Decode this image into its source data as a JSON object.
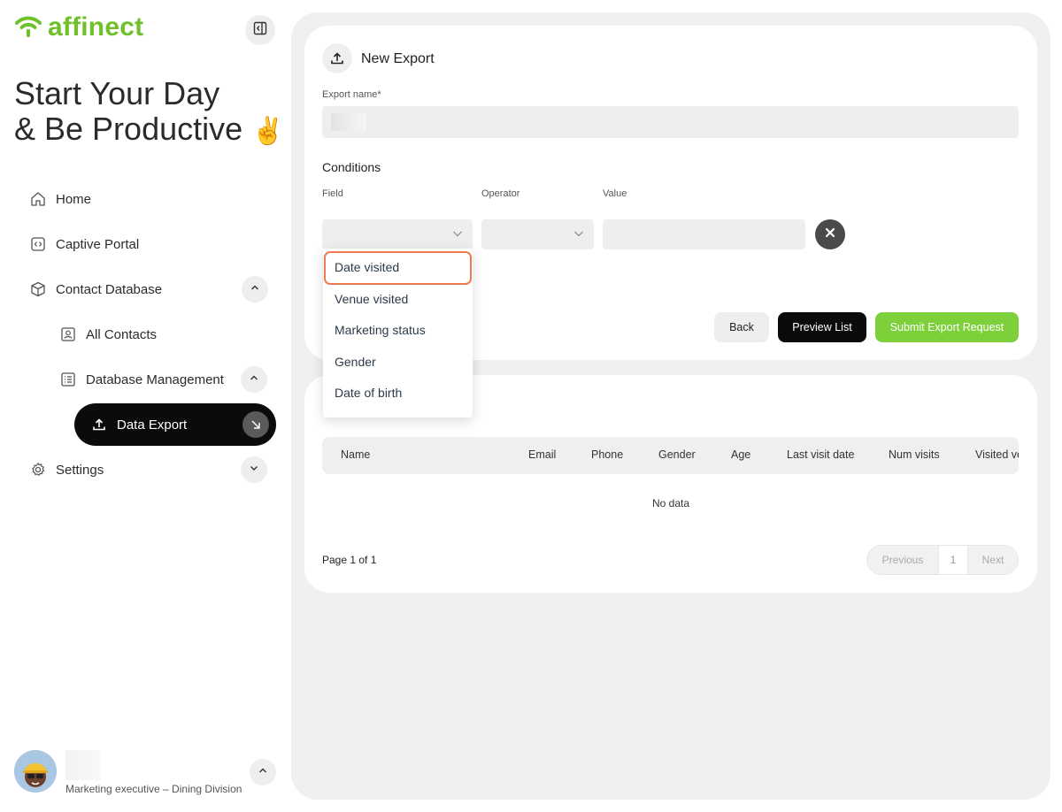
{
  "brand": {
    "name": "affinect",
    "color": "#6fc02b"
  },
  "headline": {
    "line1": "Start Your Day",
    "line2": "& Be Productive",
    "emoji": "✌️"
  },
  "nav": {
    "home": "Home",
    "captive_portal": "Captive Portal",
    "contact_database": "Contact Database",
    "all_contacts": "All Contacts",
    "database_management": "Database Management",
    "data_export": "Data Export",
    "settings": "Settings"
  },
  "user": {
    "role": "Marketing executive – Dining Division"
  },
  "export_form": {
    "title": "New Export",
    "export_name_label": "Export name*",
    "conditions_label": "Conditions",
    "field_label": "Field",
    "operator_label": "Operator",
    "value_label": "Value",
    "back_label": "Back",
    "preview_label": "Preview List",
    "submit_label": "Submit Export Request"
  },
  "field_dropdown": {
    "options": [
      "Date visited",
      "Venue visited",
      "Marketing status",
      "Gender",
      "Date of birth"
    ],
    "highlighted": "Date visited"
  },
  "table": {
    "columns": [
      "Name",
      "Email",
      "Phone",
      "Gender",
      "Age",
      "Last visit date",
      "Num visits",
      "Visited ve"
    ],
    "empty_text": "No data",
    "page_info": "Page 1 of 1",
    "prev_label": "Previous",
    "page_number": "1",
    "next_label": "Next"
  },
  "colors": {
    "accent_green": "#7ed03a",
    "highlight_orange": "#ee7b4d",
    "dark": "#0b0b0b"
  }
}
